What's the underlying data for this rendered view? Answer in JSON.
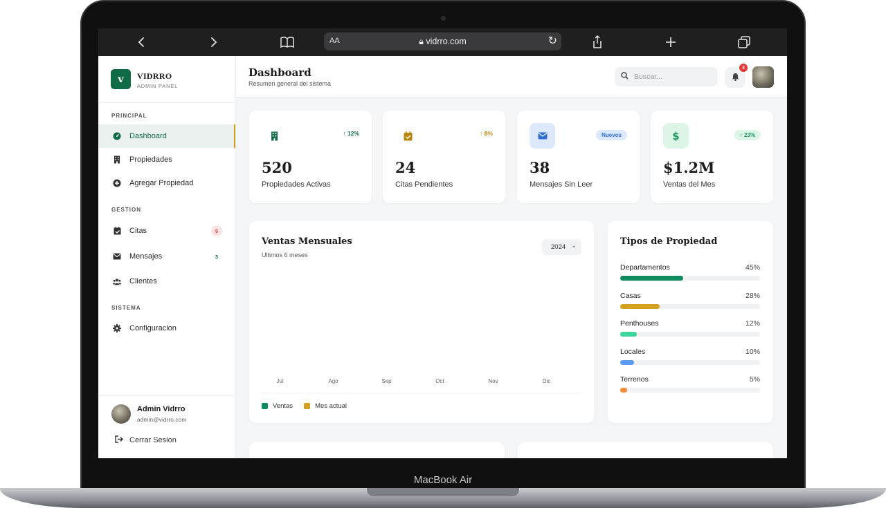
{
  "device": {
    "brand": "MacBook Air"
  },
  "browser": {
    "text_size_label": "AA",
    "url": "vidrro.com"
  },
  "sidebar": {
    "logo_letter": "v",
    "brand_name": "VIDRRO",
    "brand_sub": "ADMIN PANEL",
    "sections": [
      {
        "title": "PRINCIPAL"
      },
      {
        "title": "GESTION"
      },
      {
        "title": "SISTEMA"
      }
    ],
    "items": [
      {
        "label": "Dashboard",
        "icon": "gauge-icon"
      },
      {
        "label": "Propiedades",
        "icon": "building-icon"
      },
      {
        "label": "Agregar Propiedad",
        "icon": "plus-circle-icon"
      },
      {
        "label": "Citas",
        "icon": "calendar-check-icon",
        "badge": "5"
      },
      {
        "label": "Mensajes",
        "icon": "envelope-icon",
        "badge": "3"
      },
      {
        "label": "Clientes",
        "icon": "users-icon"
      },
      {
        "label": "Configuracion",
        "icon": "gear-icon"
      }
    ],
    "user": {
      "name": "Admin Vidrro",
      "email": "admin@vidrro.com"
    },
    "logout_label": "Cerrar Sesion"
  },
  "header": {
    "title": "Dashboard",
    "subtitle": "Resumen general del sistema",
    "search_placeholder": "Buscar...",
    "notification_count": "3"
  },
  "stats": [
    {
      "value": "520",
      "label": "Propiedades Activas",
      "trend": "↑ 12%",
      "icon": "building-icon",
      "color": "#0f6b45"
    },
    {
      "value": "24",
      "label": "Citas Pendientes",
      "trend": "↑ 8%",
      "icon": "calendar-check-icon",
      "color": "#b8860b"
    },
    {
      "value": "38",
      "label": "Mensajes Sin Leer",
      "pill": "Nuevos",
      "icon": "envelope-icon",
      "color": "#2f6fd6"
    },
    {
      "value": "$1.2M",
      "label": "Ventas del Mes",
      "trend": "↑ 23%",
      "icon": "dollar-icon",
      "color": "#1a9a5c"
    }
  ],
  "sales_chart": {
    "title": "Ventas Mensuales",
    "subtitle": "Ultimos 6 meses",
    "year": "2024",
    "legend": [
      {
        "name": "Ventas",
        "color": "#0f8a5f"
      },
      {
        "name": "Mes actual",
        "color": "#d4a020"
      }
    ]
  },
  "chart_data": {
    "type": "bar",
    "categories": [
      "Jul",
      "Ago",
      "Sep",
      "Oct",
      "Nov",
      "Dic"
    ],
    "series": [],
    "title": "Ventas Mensuales",
    "xlabel": "",
    "ylabel": ""
  },
  "property_types": {
    "title": "Tipos de Propiedad",
    "items": [
      {
        "name": "Departamentos",
        "pct": "45%",
        "value": 45,
        "color": "#0f8a5f"
      },
      {
        "name": "Casas",
        "pct": "28%",
        "value": 28,
        "color": "#d4a020"
      },
      {
        "name": "Penthouses",
        "pct": "12%",
        "value": 12,
        "color": "#3ad69a"
      },
      {
        "name": "Locales",
        "pct": "10%",
        "value": 10,
        "color": "#5b9cf0"
      },
      {
        "name": "Terrenos",
        "pct": "5%",
        "value": 5,
        "color": "#f28c3a"
      }
    ]
  }
}
